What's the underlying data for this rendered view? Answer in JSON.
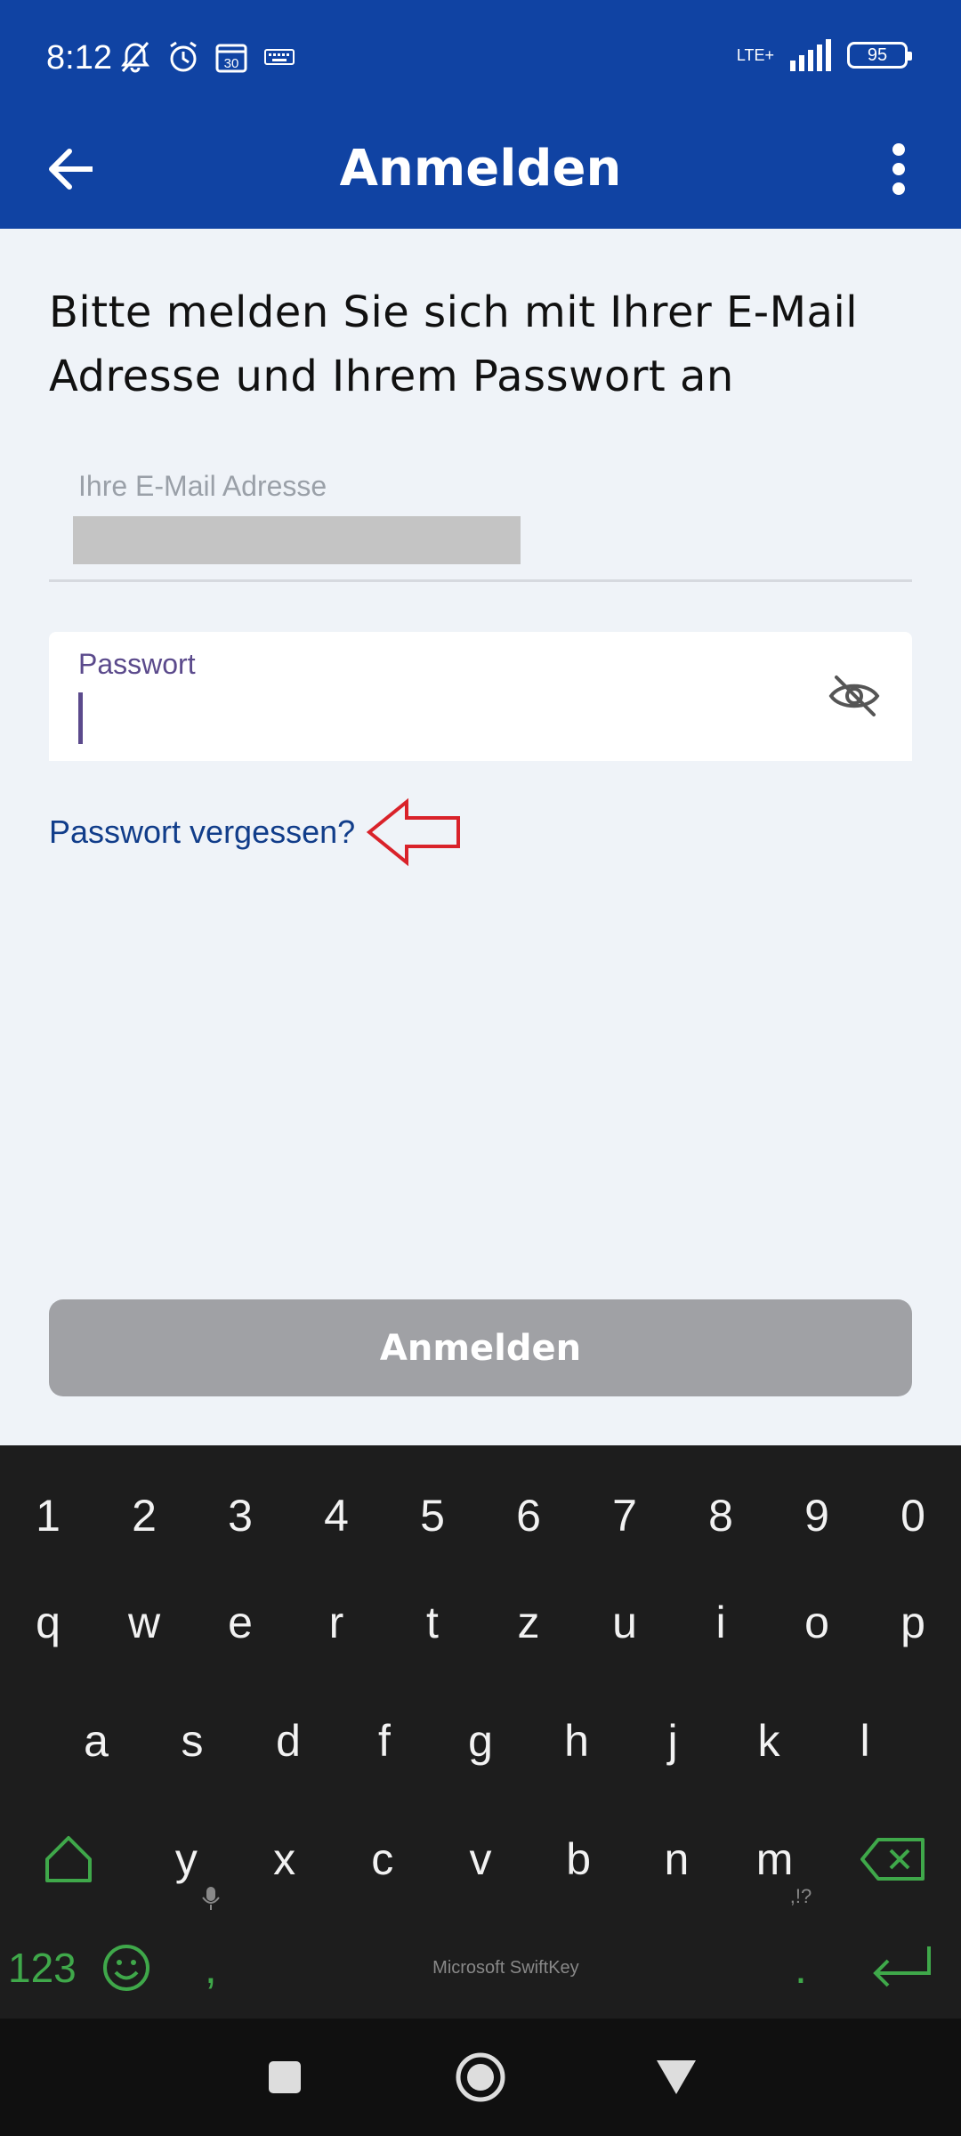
{
  "status_bar": {
    "time": "8:12",
    "network": "LTE+",
    "battery": "95",
    "icons_left": [
      "bell-off-icon",
      "alarm-icon",
      "calendar-icon",
      "keyboard-icon"
    ]
  },
  "app_bar": {
    "title": "Anmelden",
    "back_icon": "arrow-left-icon",
    "menu_icon": "more-vertical-icon"
  },
  "intro_text": "Bitte melden Sie sich mit Ihrer E-Mail Adresse und Ihrem Passwort an",
  "email_field": {
    "label": "Ihre E-Mail Adresse"
  },
  "password_field": {
    "label": "Passwort",
    "toggle_icon": "eye-off-icon"
  },
  "forgot_password": "Passwort vergessen?",
  "submit_label": "Anmelden",
  "keyboard": {
    "row_numbers": [
      "1",
      "2",
      "3",
      "4",
      "5",
      "6",
      "7",
      "8",
      "9",
      "0"
    ],
    "row_q": [
      "q",
      "w",
      "e",
      "r",
      "t",
      "z",
      "u",
      "i",
      "o",
      "p"
    ],
    "row_a": [
      "a",
      "s",
      "d",
      "f",
      "g",
      "h",
      "j",
      "k",
      "l"
    ],
    "row_z": [
      "y",
      "x",
      "c",
      "v",
      "b",
      "n",
      "m"
    ],
    "numbers_key": "123",
    "comma_key": ",",
    "period_key": ".",
    "period_sub": ",!?",
    "brand": "Microsoft SwiftKey"
  },
  "colors": {
    "primary": "#1043a3",
    "link": "#113d8a",
    "accent_purple": "#5b4a8c",
    "button_disabled": "#a0a1a5",
    "keyboard_bg": "#1d1d1d",
    "keyboard_accent": "#3fa84a",
    "annotation_arrow": "#d9222a"
  }
}
